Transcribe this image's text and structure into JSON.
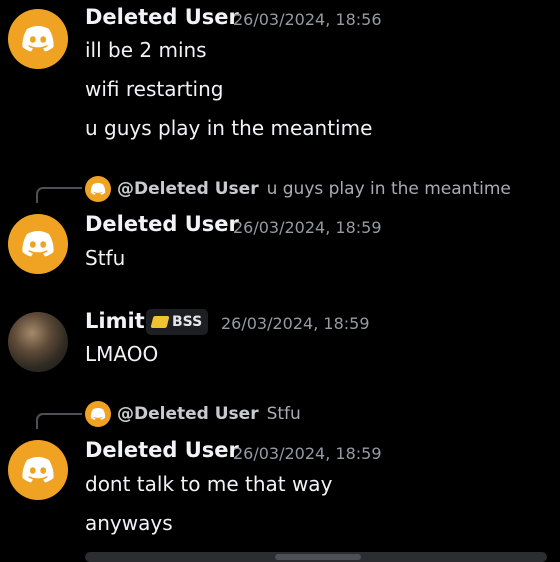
{
  "colors": {
    "background": "#000000",
    "avatar_orange": "#f0a323",
    "username": "#f2f3f5",
    "timestamp": "#949ba4",
    "reply_text": "#a9adb3"
  },
  "messages": [
    {
      "author": "Deleted User",
      "timestamp": "26/03/2024, 18:56",
      "avatar_icon": "discord-logo-icon",
      "lines": [
        "ill be 2 mins",
        "wifi restarting",
        "u guys play in the meantime"
      ]
    },
    {
      "reply": {
        "author": "@Deleted User",
        "text": "u guys play in the meantime"
      },
      "author": "Deleted User",
      "timestamp": "26/03/2024, 18:59",
      "avatar_icon": "discord-logo-icon",
      "lines": [
        "Stfu"
      ]
    },
    {
      "author": "Limit",
      "tag": {
        "label": "BSS",
        "icon": "bss-tag-icon"
      },
      "timestamp": "26/03/2024, 18:59",
      "avatar_icon": "user-photo",
      "lines": [
        "LMAOO"
      ]
    },
    {
      "reply": {
        "author": "@Deleted User",
        "text": "Stfu"
      },
      "author": "Deleted User",
      "timestamp": "26/03/2024, 18:59",
      "avatar_icon": "discord-logo-icon",
      "lines": [
        "dont talk to me that way",
        "anyways"
      ]
    }
  ]
}
